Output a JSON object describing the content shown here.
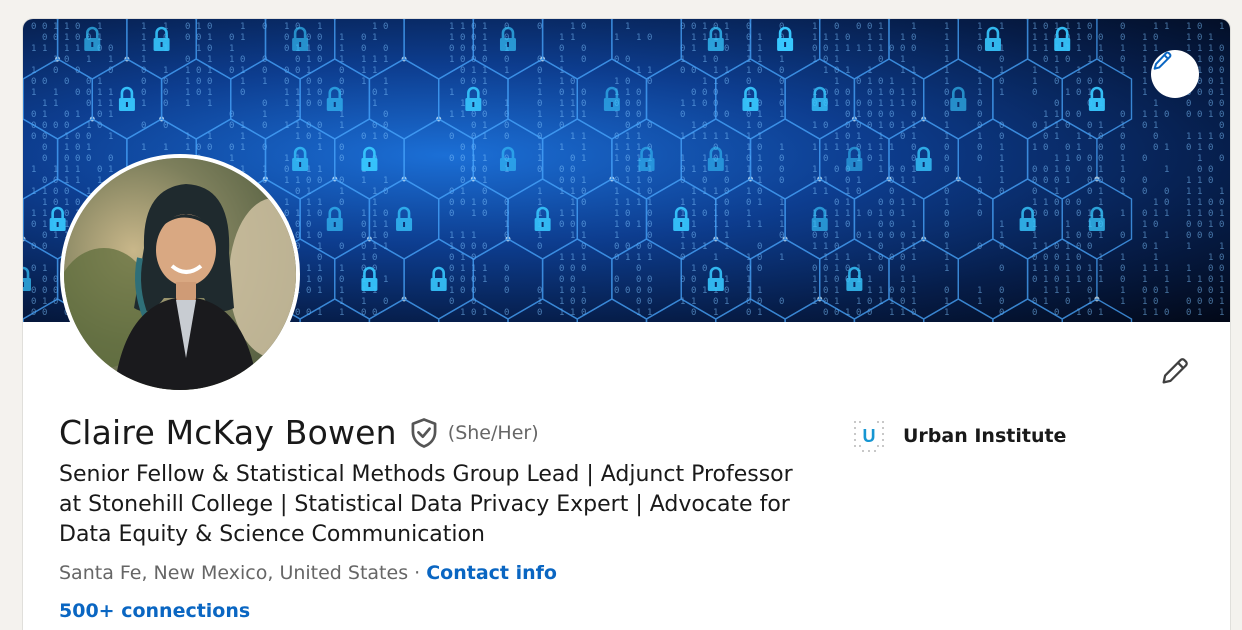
{
  "profile": {
    "name": "Claire McKay Bowen",
    "pronouns": "(She/Her)",
    "headline": "Senior Fellow & Statistical Methods Group Lead | Adjunct Professor at Stonehill College | Statistical Data Privacy Expert | Advocate for Data Equity & Science Communication",
    "location": "Santa Fe, New Mexico, United States",
    "separator": " · ",
    "contact_label": "Contact info",
    "connections_label": "500+ connections"
  },
  "company": {
    "name": "Urban Institute",
    "logo_letter": "U"
  },
  "icons": {
    "edit_banner": "pencil-icon",
    "edit_intro": "pencil-icon",
    "verified": "verified-shield-icon",
    "banner_motif": "padlock-icon"
  },
  "colors": {
    "accent": "#0a66c2",
    "page_bg": "#f4f2ee",
    "banner_glow": "#37c8ff"
  }
}
